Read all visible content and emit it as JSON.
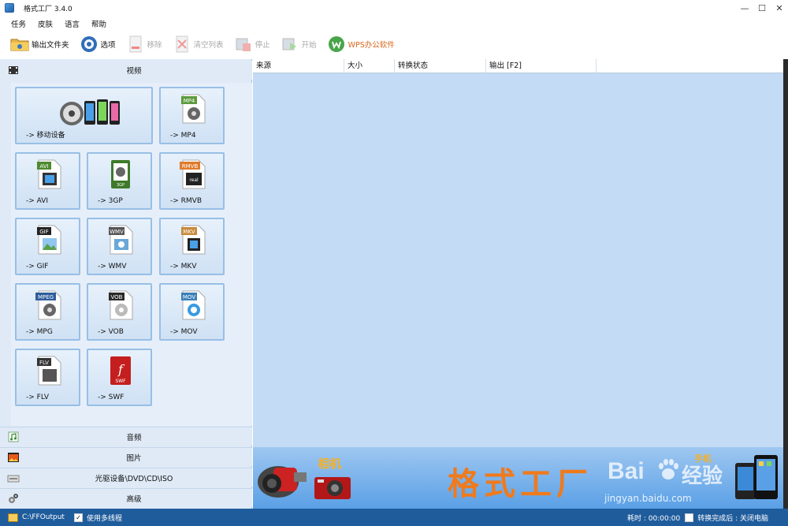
{
  "window": {
    "title": "格式工厂 3.4.0"
  },
  "menu": [
    "任务",
    "皮肤",
    "语言",
    "帮助"
  ],
  "toolbar": {
    "output_folder": "输出文件夹",
    "options": "选项",
    "remove": "移除",
    "clear_list": "清空列表",
    "stop": "停止",
    "start": "开始",
    "wps": "WPS办公软件"
  },
  "categories": {
    "video": "视频",
    "audio": "音频",
    "image": "图片",
    "rom": "光驱设备\\DVD\\CD\\ISO",
    "advanced": "高级"
  },
  "tiles": [
    {
      "label": "-> 移动设备",
      "icon": "mobile-devices-icon"
    },
    {
      "label": "-> MP4",
      "badge": "MP4",
      "badge_color": "#5a9a3c",
      "icon": "mp4-file-icon"
    },
    {
      "label": "-> AVI",
      "badge": "AVI",
      "badge_color": "#4d8a2e",
      "icon": "avi-file-icon"
    },
    {
      "label": "-> 3GP",
      "badge": "3GP",
      "badge_color": "#3e7a2a",
      "icon": "3gp-file-icon"
    },
    {
      "label": "-> RMVB",
      "badge": "RMVB",
      "badge_color": "#e07a2a",
      "icon": "rmvb-file-icon"
    },
    {
      "label": "-> GIF",
      "badge": "GIF",
      "badge_color": "#222222",
      "icon": "gif-file-icon"
    },
    {
      "label": "-> WMV",
      "badge": "WMV",
      "badge_color": "#555555",
      "icon": "wmv-file-icon"
    },
    {
      "label": "-> MKV",
      "badge": "MKV",
      "badge_color": "#c88a3a",
      "icon": "mkv-file-icon"
    },
    {
      "label": "-> MPG",
      "badge": "MPEG",
      "badge_color": "#2e5d9c",
      "icon": "mpg-file-icon"
    },
    {
      "label": "-> VOB",
      "badge": "VOB",
      "badge_color": "#2a2a2a",
      "icon": "vob-file-icon"
    },
    {
      "label": "-> MOV",
      "badge": "MOV",
      "badge_color": "#3a7fb8",
      "icon": "mov-file-icon"
    },
    {
      "label": "-> FLV",
      "badge": "FLV",
      "badge_color": "#333333",
      "icon": "flv-file-icon"
    },
    {
      "label": "-> SWF",
      "badge": "SWF",
      "badge_color": "#c41e1e",
      "icon": "swf-file-icon"
    }
  ],
  "list": {
    "columns": [
      "来源",
      "大小",
      "转换状态",
      "输出 [F2]"
    ]
  },
  "banner": {
    "camera_label": "相机",
    "brand": "格式工厂",
    "phone_label": "手机",
    "watermark": "Bai",
    "watermark_sub": "jingyan.baidu.com",
    "watermark_tail": "经验"
  },
  "status": {
    "output_path": "C:\\FFOutput",
    "multithread": "使用多线程",
    "elapsed": "耗时 : 00:00:00",
    "after_convert": "转换完成后 : 关闭电脑"
  },
  "colors": {
    "accent": "#1f5c9c",
    "panel_bg": "#dfeaf6",
    "list_bg": "#c3dbf5",
    "brand_text": "#f07a1c"
  }
}
